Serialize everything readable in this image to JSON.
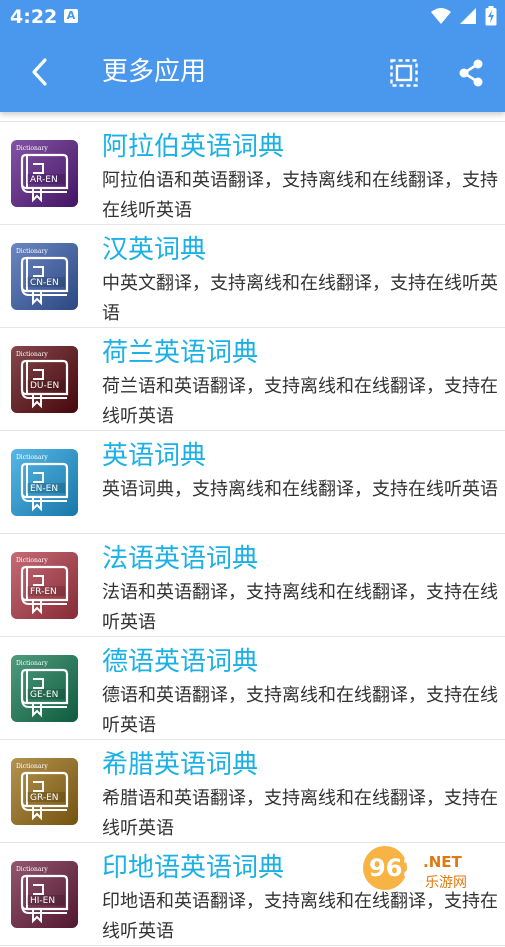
{
  "status": {
    "time": "4:22",
    "notif_letter": "A"
  },
  "header": {
    "title": "更多应用"
  },
  "items": [
    {
      "title": "阿拉伯英语词典",
      "desc": "阿拉伯语和英语翻译，支持离线和在线翻译，支持在线听英语",
      "code": "AR-EN",
      "dict_label": "Dictionary",
      "color": "#5a1a86"
    },
    {
      "title": "汉英词典",
      "desc": "中英文翻译，支持离线和在线翻译，支持在线听英语",
      "code": "CN-EN",
      "dict_label": "Dictionary",
      "color": "#3a5fae"
    },
    {
      "title": "荷兰英语词典",
      "desc": "荷兰语和英语翻译，支持离线和在线翻译，支持在线听英语",
      "code": "DU-EN",
      "dict_label": "Dictionary",
      "color": "#5c0a10"
    },
    {
      "title": "英语词典",
      "desc": "英语词典，支持离线和在线翻译，支持在线听英语",
      "code": "EN-EN",
      "dict_label": "Dictionary",
      "color": "#1f9fde"
    },
    {
      "title": "法语英语词典",
      "desc": "法语和英语翻译，支持离线和在线翻译，支持在线听英语",
      "code": "FR-EN",
      "dict_label": "Dictionary",
      "color": "#b33a48"
    },
    {
      "title": "德语英语词典",
      "desc": "德语和英语翻译，支持离线和在线翻译，支持在线听英语",
      "code": "GE-EN",
      "dict_label": "Dictionary",
      "color": "#137a52"
    },
    {
      "title": "希腊英语词典",
      "desc": "希腊语和英语翻译，支持离线和在线翻译，支持在线听英语",
      "code": "GR-EN",
      "dict_label": "Dictionary",
      "color": "#9a6f14"
    },
    {
      "title": "印地语英语词典",
      "desc": "印地语和英语翻译，支持离线和在线翻译，支持在线听英语",
      "code": "HI-EN",
      "dict_label": "Dictionary",
      "color": "#6d1f3e"
    }
  ],
  "watermark": {
    "number": "962",
    "suffix": ".NET",
    "site": "乐游网"
  },
  "colors": {
    "appbar": "#4a97ee",
    "title_text": "#1cb1e6"
  }
}
